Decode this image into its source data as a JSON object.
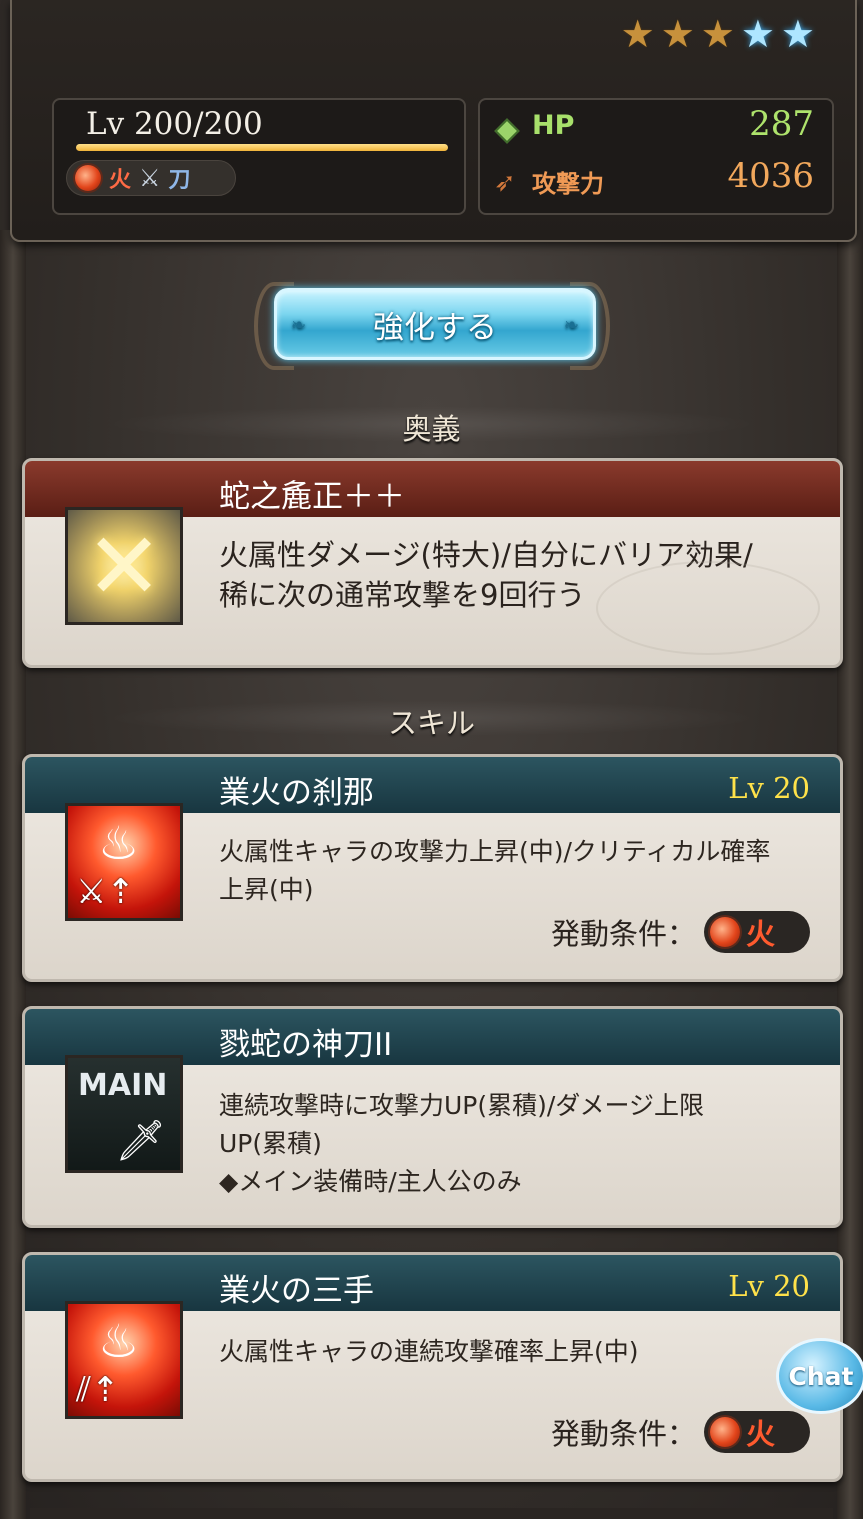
{
  "header": {
    "stars": [
      "bronze",
      "bronze",
      "bronze",
      "blue",
      "blue"
    ],
    "level_text": "Lv 200/200",
    "element_tag": "火",
    "weapon_tag": "刀",
    "hp_label": "HP",
    "hp_value": "287",
    "atk_label": "攻撃力",
    "atk_value": "4036"
  },
  "upgrade_button": "強化する",
  "ougi_section": {
    "title": "奥義",
    "name": "蛇之麁正＋＋",
    "description": "火属性ダメージ(特大)/自分にバリア効果/\n稀に次の通常攻撃を9回行う"
  },
  "skill_section": {
    "title": "スキル",
    "skills": [
      {
        "name": "業火の刹那",
        "level": "Lv 20",
        "description": "火属性キャラの攻撃力上昇(中)/クリティカル確率\n上昇(中)",
        "condition_label": "発動条件：",
        "condition_element": "火"
      },
      {
        "name": "戮蛇の神刀II",
        "icon_text": "MAIN",
        "description": "連続攻撃時に攻撃力UP(累積)/ダメージ上限\nUP(累積)\n◆メイン装備時/主人公のみ"
      },
      {
        "name": "業火の三手",
        "level": "Lv 20",
        "description": "火属性キャラの連続攻撃確率上昇(中)",
        "condition_label": "発動条件：",
        "condition_element": "火"
      }
    ]
  },
  "chat_button": "Chat",
  "colors": {
    "hp": "#a8e06b",
    "atk": "#f2a85c",
    "level_yellow": "#ffe24a",
    "button_blue": "#33a6cf"
  }
}
